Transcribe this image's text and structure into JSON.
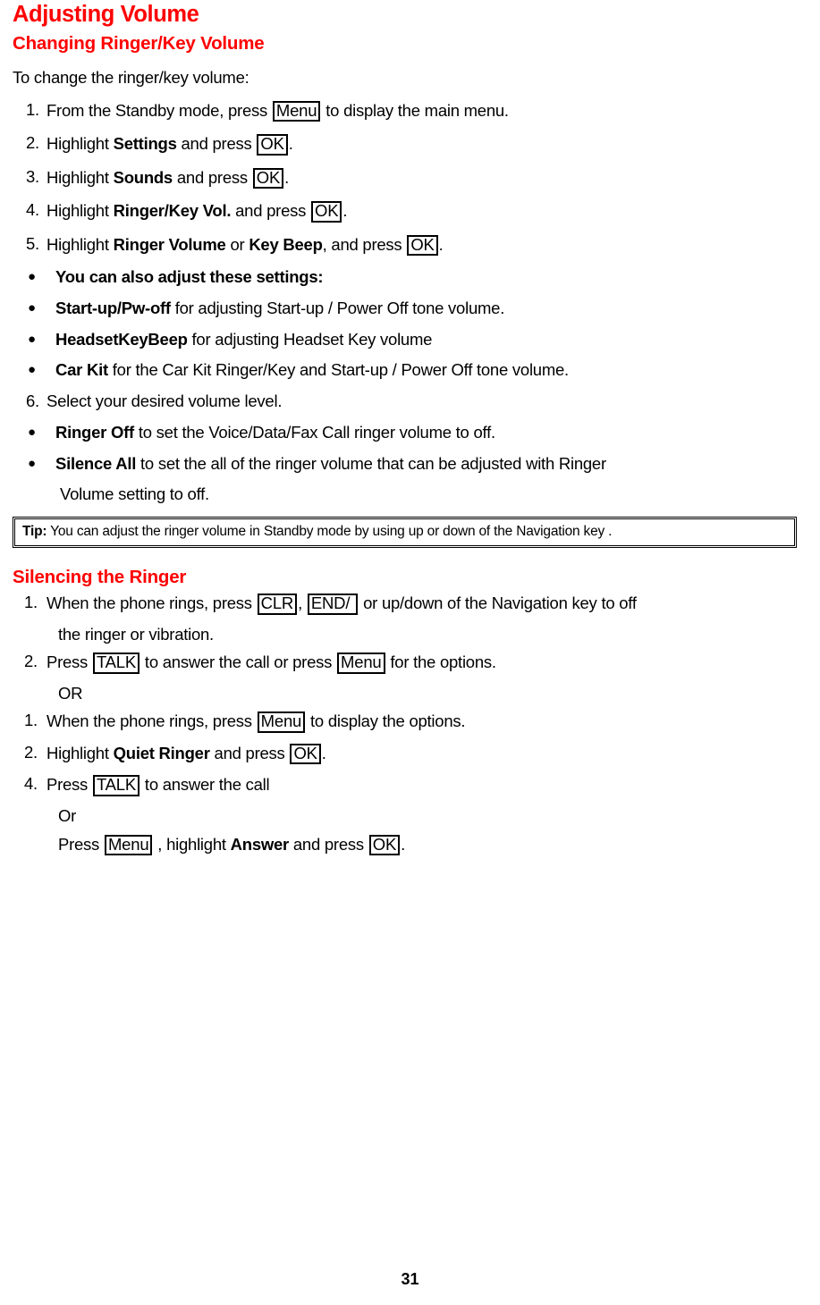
{
  "page": {
    "number": "31",
    "heading_color": "#ff0000",
    "text_color": "#000000",
    "background": "#ffffff"
  },
  "title": "Adjusting Volume",
  "section1": {
    "heading": "Changing Ringer/Key Volume",
    "intro": "To change the ringer/key volume:",
    "steps": [
      {
        "marker": "1.",
        "type": "number",
        "parts": [
          {
            "kind": "text",
            "text": "From the Standby mode, press "
          },
          {
            "kind": "key",
            "text": "Menu"
          },
          {
            "kind": "text",
            "text": " to display the main menu."
          }
        ]
      },
      {
        "marker": "2.",
        "type": "number",
        "parts": [
          {
            "kind": "text",
            "text": "Highlight "
          },
          {
            "kind": "bold",
            "text": "Settings"
          },
          {
            "kind": "text",
            "text": " and press "
          },
          {
            "kind": "key",
            "text": "OK"
          },
          {
            "kind": "text",
            "text": "."
          }
        ]
      },
      {
        "marker": "3.",
        "type": "number",
        "parts": [
          {
            "kind": "text",
            "text": "Highlight "
          },
          {
            "kind": "bold",
            "text": "Sounds"
          },
          {
            "kind": "text",
            "text": " and press "
          },
          {
            "kind": "key",
            "text": "OK"
          },
          {
            "kind": "text",
            "text": "."
          }
        ]
      },
      {
        "marker": "4.",
        "type": "number",
        "parts": [
          {
            "kind": "text",
            "text": "Highlight "
          },
          {
            "kind": "bold",
            "text": "Ringer/Key Vol."
          },
          {
            "kind": "text",
            "text": " and press "
          },
          {
            "kind": "key",
            "text": "OK"
          },
          {
            "kind": "text",
            "text": "."
          }
        ]
      },
      {
        "marker": "5.",
        "type": "number",
        "parts": [
          {
            "kind": "text",
            "text": "Highlight "
          },
          {
            "kind": "bold",
            "text": "Ringer Volume"
          },
          {
            "kind": "text",
            "text": " or "
          },
          {
            "kind": "bold",
            "text": "Key Beep"
          },
          {
            "kind": "text",
            "text": ", and press "
          },
          {
            "kind": "key",
            "text": "OK"
          },
          {
            "kind": "text",
            "text": "."
          }
        ]
      },
      {
        "marker": "●",
        "type": "bullet",
        "parts": [
          {
            "kind": "bold",
            "text": "You can also adjust these settings:"
          }
        ]
      },
      {
        "marker": "●",
        "type": "bullet",
        "parts": [
          {
            "kind": "bold",
            "text": "Start-up/Pw-off"
          },
          {
            "kind": "text",
            "text": " for adjusting Start-up / Power Off tone volume."
          }
        ]
      },
      {
        "marker": "●",
        "type": "bullet",
        "parts": [
          {
            "kind": "bold",
            "text": "HeadsetKeyBeep"
          },
          {
            "kind": "text",
            "text": " for adjusting Headset Key volume"
          }
        ]
      },
      {
        "marker": "●",
        "type": "bullet",
        "parts": [
          {
            "kind": "bold",
            "text": "Car Kit"
          },
          {
            "kind": "text",
            "text": " for the Car Kit Ringer/Key and Start-up / Power Off tone volume."
          }
        ]
      },
      {
        "marker": "6.",
        "type": "number",
        "parts": [
          {
            "kind": "text",
            "text": "Select your desired volume level."
          }
        ]
      },
      {
        "marker": "●",
        "type": "bullet",
        "parts": [
          {
            "kind": "bold",
            "text": "Ringer Off"
          },
          {
            "kind": "text",
            "text": " to set the Voice/Data/Fax Call ringer volume to off."
          }
        ]
      },
      {
        "marker": "●",
        "type": "bullet",
        "parts": [
          {
            "kind": "bold",
            "text": "Silence All"
          },
          {
            "kind": "text",
            "text": " to set the all of the ringer volume that can be adjusted with Ringer"
          }
        ]
      }
    ],
    "continuation": "Volume setting to off.",
    "tip": {
      "label": "Tip:",
      "text": " You can adjust the ringer volume in Standby mode by using up or down of the Navigation key ."
    }
  },
  "section2": {
    "heading": "Silencing the Ringer",
    "steps": [
      {
        "marker": "1.",
        "type": "number",
        "parts": [
          {
            "kind": "text",
            "text": "When the phone rings, press "
          },
          {
            "kind": "key",
            "text": "CLR"
          },
          {
            "kind": "text",
            "text": ", "
          },
          {
            "kind": "key",
            "text": "END/ "
          },
          {
            "kind": "text",
            "text": " or  up/down of the Navigation key to off"
          }
        ]
      },
      {
        "marker": "",
        "type": "continuation",
        "parts": [
          {
            "kind": "text",
            "text": "the ringer or vibration."
          }
        ]
      },
      {
        "marker": "2.",
        "type": "number",
        "parts": [
          {
            "kind": "text",
            "text": "Press "
          },
          {
            "kind": "key",
            "text": "TALK"
          },
          {
            "kind": "text",
            "text": " to answer the call or press "
          },
          {
            "kind": "key",
            "text": "Menu"
          },
          {
            "kind": "text",
            "text": " for the options."
          }
        ]
      },
      {
        "marker": "",
        "type": "continuation",
        "parts": [
          {
            "kind": "text",
            "text": "OR"
          }
        ]
      },
      {
        "marker": "1.",
        "type": "number",
        "parts": [
          {
            "kind": "text",
            "text": "When the phone rings, press "
          },
          {
            "kind": "key",
            "text": "Menu"
          },
          {
            "kind": "text",
            "text": " to display the options."
          }
        ]
      },
      {
        "marker": "2.",
        "type": "number",
        "parts": [
          {
            "kind": "text",
            "text": "Highlight "
          },
          {
            "kind": "bold",
            "text": "Quiet Ringer"
          },
          {
            "kind": "text",
            "text": " and press "
          },
          {
            "kind": "key",
            "text": "OK"
          },
          {
            "kind": "text",
            "text": "."
          }
        ]
      },
      {
        "marker": "4.",
        "type": "number",
        "parts": [
          {
            "kind": "text",
            "text": "Press "
          },
          {
            "kind": "key",
            "text": "TALK"
          },
          {
            "kind": "text",
            "text": " to answer the call"
          }
        ]
      },
      {
        "marker": "",
        "type": "continuation",
        "parts": [
          {
            "kind": "text",
            "text": "Or"
          }
        ]
      },
      {
        "marker": "",
        "type": "continuation",
        "parts": [
          {
            "kind": "text",
            "text": "Press "
          },
          {
            "kind": "key",
            "text": "Menu"
          },
          {
            "kind": "text",
            "text": " , highlight "
          },
          {
            "kind": "bold",
            "text": "Answer"
          },
          {
            "kind": "text",
            "text": " and press "
          },
          {
            "kind": "key",
            "text": "OK"
          },
          {
            "kind": "text",
            "text": "."
          }
        ]
      }
    ]
  }
}
